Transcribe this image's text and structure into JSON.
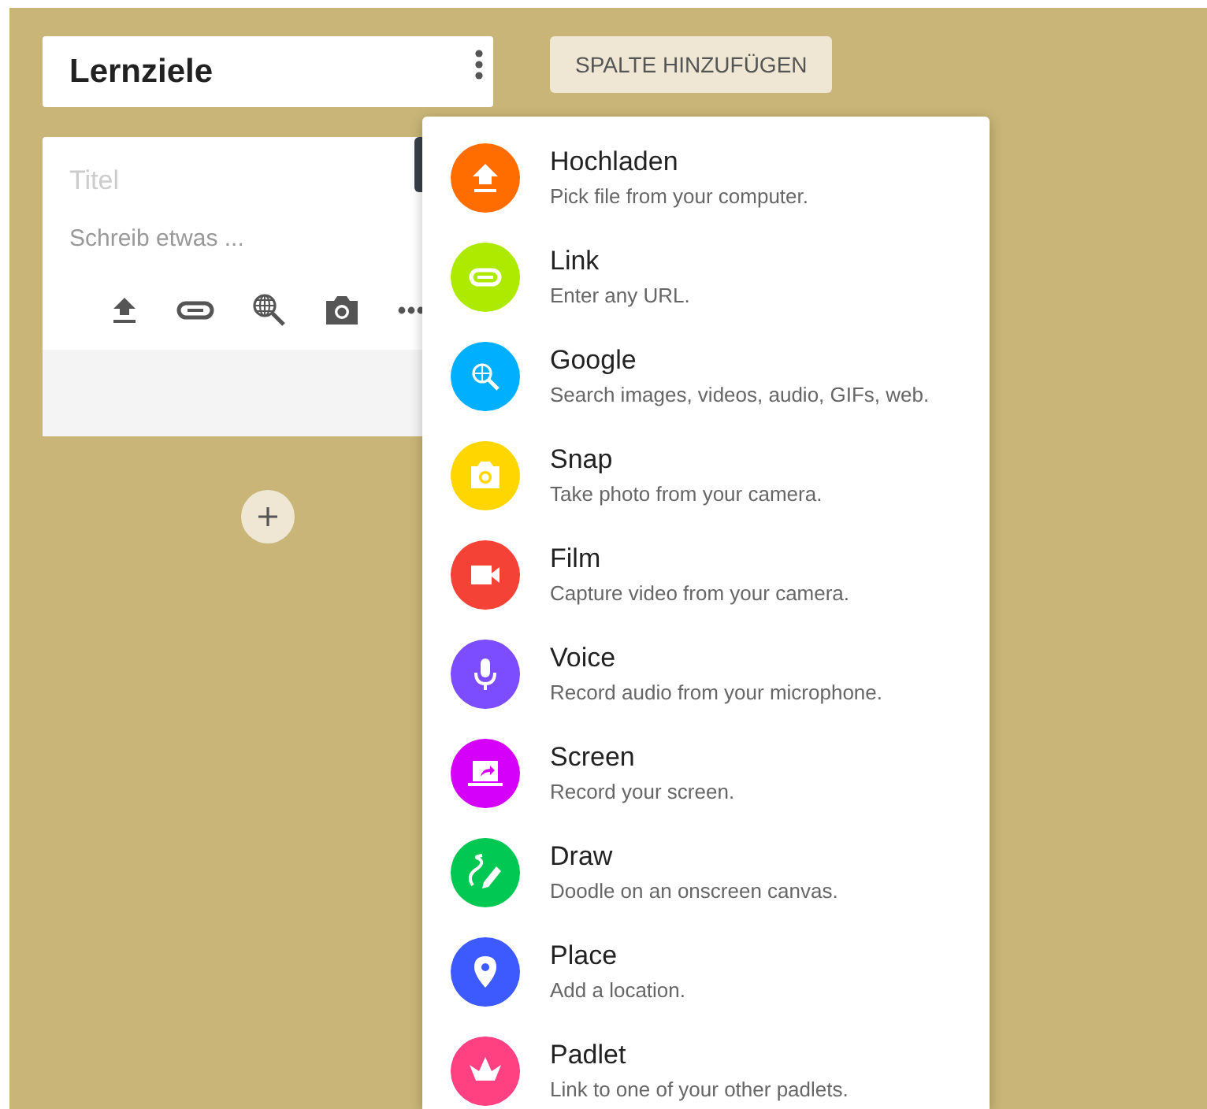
{
  "column": {
    "title": "Lernziele"
  },
  "add_column_button": "SPALTE HINZUFÜGEN",
  "post": {
    "title_placeholder": "Titel",
    "body_placeholder": "Schreib etwas ..."
  },
  "attachment_menu": [
    {
      "kind": "upload",
      "color": "#ff6d00",
      "label": "Hochladen",
      "description": "Pick file from your computer."
    },
    {
      "kind": "link",
      "color": "#aeea00",
      "label": "Link",
      "description": "Enter any URL."
    },
    {
      "kind": "search",
      "color": "#00b0ff",
      "label": "Google",
      "description": "Search images, videos, audio, GIFs, web."
    },
    {
      "kind": "camera",
      "color": "#ffd600",
      "label": "Snap",
      "description": "Take photo from your camera."
    },
    {
      "kind": "video",
      "color": "#f44336",
      "label": "Film",
      "description": "Capture video from your camera."
    },
    {
      "kind": "mic",
      "color": "#7c4dff",
      "label": "Voice",
      "description": "Record audio from your microphone."
    },
    {
      "kind": "screen",
      "color": "#d500f9",
      "label": "Screen",
      "description": "Record your screen."
    },
    {
      "kind": "draw",
      "color": "#00c853",
      "label": "Draw",
      "description": "Doodle on an onscreen canvas."
    },
    {
      "kind": "place",
      "color": "#3d5afe",
      "label": "Place",
      "description": "Add a location."
    },
    {
      "kind": "padlet",
      "color": "#ff4081",
      "label": "Padlet",
      "description": "Link to one of your other padlets."
    }
  ]
}
